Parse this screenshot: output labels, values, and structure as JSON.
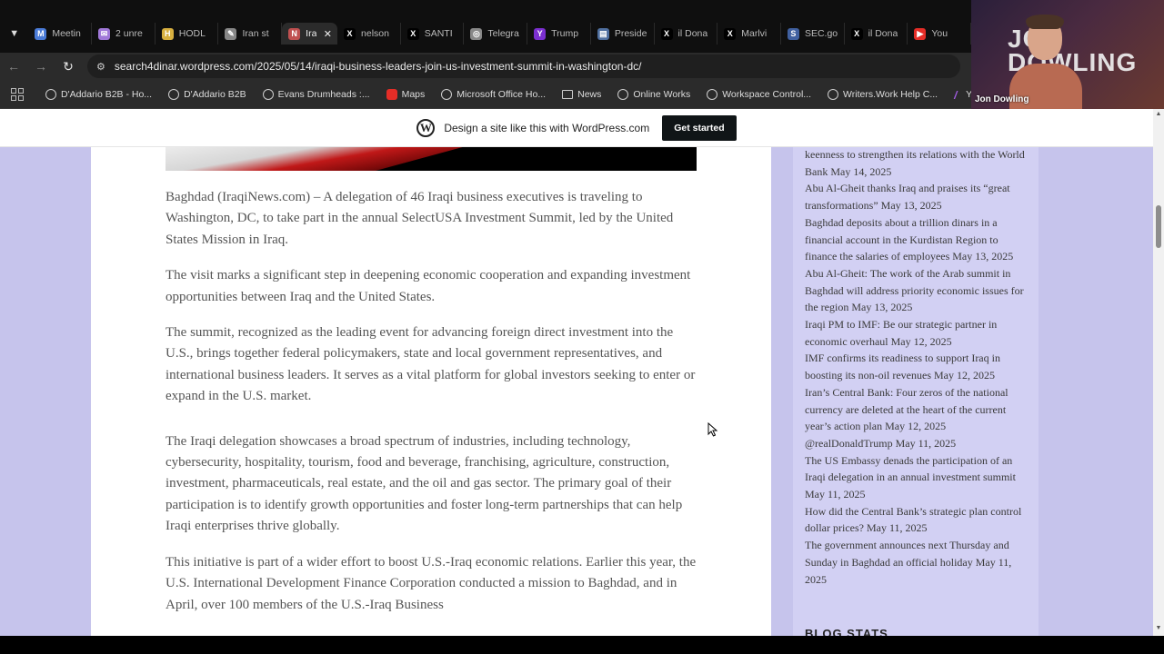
{
  "tabs": [
    {
      "title": "Meetin",
      "icon": "meet-icon",
      "color": "#4a7bd8"
    },
    {
      "title": "2 unre",
      "icon": "mail-icon",
      "color": "#a078d8"
    },
    {
      "title": "HODL",
      "icon": "hodl-icon",
      "color": "#d8b040"
    },
    {
      "title": "Iran st",
      "icon": "feather-icon",
      "color": "#888888"
    },
    {
      "title": "Ira",
      "icon": "news-icon",
      "color": "#c05050",
      "active": true
    },
    {
      "title": "nelson",
      "icon": "x-icon",
      "color": "#000000"
    },
    {
      "title": "SANTI",
      "icon": "x-icon",
      "color": "#000000"
    },
    {
      "title": "Telegra",
      "icon": "globe-icon",
      "color": "#888888"
    },
    {
      "title": "Trump",
      "icon": "yahoo-icon",
      "color": "#7b2fd0"
    },
    {
      "title": "Preside",
      "icon": "doc-icon",
      "color": "#5070a0"
    },
    {
      "title": "il Dona",
      "icon": "x-icon",
      "color": "#000000"
    },
    {
      "title": "Marlvi",
      "icon": "x-icon",
      "color": "#000000"
    },
    {
      "title": "SEC.go",
      "icon": "sec-icon",
      "color": "#4060a0"
    },
    {
      "title": "il Dona",
      "icon": "x-icon",
      "color": "#000000"
    },
    {
      "title": "You",
      "icon": "youtube-icon",
      "color": "#e52d27"
    }
  ],
  "toolbar": {
    "url": "search4dinar.wordpress.com/2025/05/14/iraqi-business-leaders-join-us-investment-summit-in-washington-dc/"
  },
  "bookmarks": [
    {
      "label": "D'Addario B2B - Ho...",
      "icon": "globe-icon"
    },
    {
      "label": "D'Addario B2B",
      "icon": "globe-icon"
    },
    {
      "label": "Evans Drumheads :...",
      "icon": "globe-icon"
    },
    {
      "label": "Maps",
      "icon": "youtube-icon"
    },
    {
      "label": "Microsoft Office Ho...",
      "icon": "globe-icon"
    },
    {
      "label": "News",
      "icon": "folder-icon"
    },
    {
      "label": "Online Works",
      "icon": "globe-icon"
    },
    {
      "label": "Workspace Control...",
      "icon": "globe-icon"
    },
    {
      "label": "Writers.Work Help C...",
      "icon": "globe-icon"
    },
    {
      "label": "Yahoo!",
      "icon": "yahoo-icon"
    }
  ],
  "webcam": {
    "overlay": "JON\nDOWLING",
    "name": "Jon Dowling"
  },
  "wpbar": {
    "text": "Design a site like this with WordPress.com",
    "button": "Get started"
  },
  "article": {
    "paragraphs": [
      "Baghdad (IraqiNews.com) – A delegation of 46 Iraqi business executives is traveling to Washington, DC, to take part in the annual SelectUSA Investment Summit, led by the United States Mission in Iraq.",
      "The visit marks a significant step in deepening economic cooperation and expanding investment opportunities between Iraq and the United States.",
      "The summit, recognized as the leading event for advancing foreign direct investment into the U.S., brings together federal policymakers, state and local government representatives, and international business leaders. It serves as a vital platform for global investors seeking to enter or expand in the U.S. market.",
      "The Iraqi delegation showcases a broad spectrum of industries, including technology, cybersecurity, hospitality, tourism, food and beverage, franchising, agriculture, construction, investment, pharmaceuticals, real estate, and the oil and gas sector. The primary goal of their participation is to identify growth opportunities and foster long-term partnerships that can help Iraqi enterprises thrive globally.",
      "This initiative is part of a wider effort to boost U.S.-Iraq economic relations. Earlier this year, the U.S. International Development Finance Corporation conducted a mission to Baghdad, and in April, over 100 members of the U.S.-Iraq Business"
    ]
  },
  "sidebar": {
    "recent_posts": [
      {
        "title": "keenness to strengthen its relations with the World Bank",
        "date": "May 14, 2025"
      },
      {
        "title": "Abu Al-Gheit thanks Iraq and praises its “great transformations”",
        "date": "May 13, 2025"
      },
      {
        "title": "Baghdad deposits about a trillion dinars in a financial account in the Kurdistan Region to finance the salaries of employees",
        "date": "May 13, 2025"
      },
      {
        "title": "Abu Al-Gheit: The work of the Arab summit in Baghdad will address priority economic issues for the region",
        "date": "May 13, 2025"
      },
      {
        "title": "Iraqi PM to IMF: Be our strategic partner in economic overhaul",
        "date": "May 12, 2025"
      },
      {
        "title": "IMF confirms its readiness to support Iraq in boosting its non-oil revenues",
        "date": "May 12, 2025"
      },
      {
        "title": "Iran’s Central Bank: Four zeros of the national currency are deleted at the heart of the current year’s action plan",
        "date": "May 12, 2025"
      },
      {
        "title": "@realDonaldTrump",
        "date": "May 11, 2025"
      },
      {
        "title": "The US Embassy denads the participation of an Iraqi delegation in an annual investment summit",
        "date": "May 11, 2025"
      },
      {
        "title": "How did the Central Bank’s strategic plan control dollar prices?",
        "date": "May 11, 2025"
      },
      {
        "title": "The government announces next Thursday and Sunday in Baghdad an official holiday",
        "date": "May 11, 2025"
      }
    ],
    "blog_stats_heading": "BLOG STATS"
  }
}
